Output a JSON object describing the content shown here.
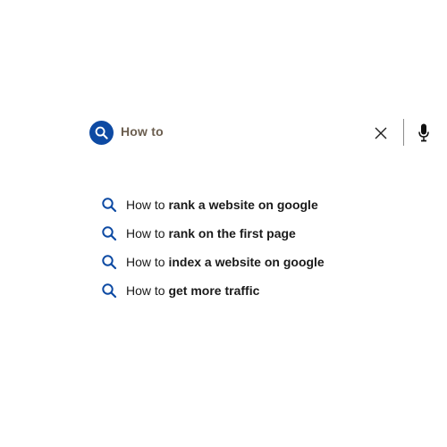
{
  "search": {
    "query": "How to",
    "accent_color": "#0d4aa3",
    "query_color": "#6b5e4f",
    "icons": {
      "search": "search-icon",
      "clear": "close-icon",
      "voice": "microphone-icon"
    }
  },
  "suggestions": [
    {
      "prefix": "How to",
      "completion": "rank a website on google",
      "icon": "search-icon"
    },
    {
      "prefix": "How to",
      "completion": "rank on the first page",
      "icon": "search-icon"
    },
    {
      "prefix": "How to",
      "completion": "index a website on google",
      "icon": "search-icon"
    },
    {
      "prefix": "How to",
      "completion": "get more traffic",
      "icon": "search-icon"
    }
  ]
}
